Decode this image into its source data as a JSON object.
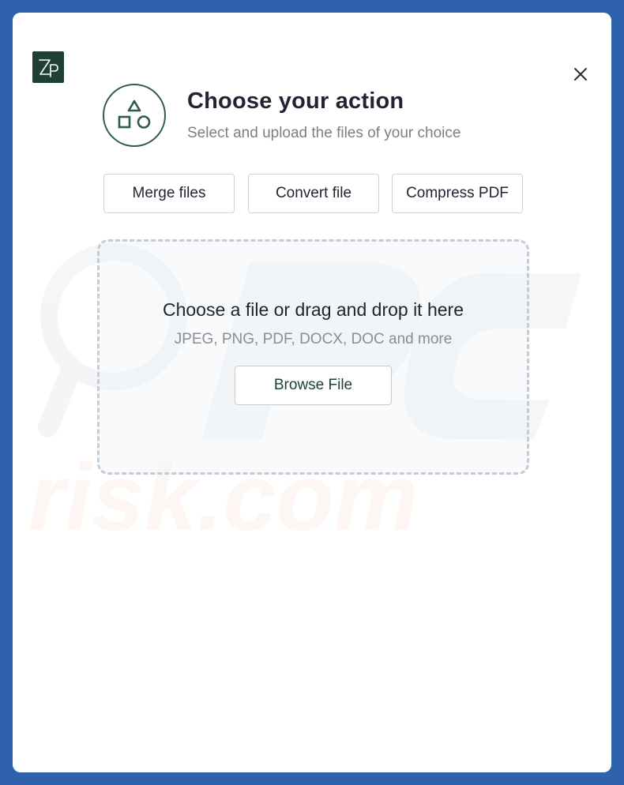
{
  "app": {
    "logo_text": "Zp",
    "close_icon": "close-icon"
  },
  "header": {
    "title": "Choose your action",
    "subtitle": "Select and upload the files of your choice",
    "icon": "shapes-icon"
  },
  "actions": [
    {
      "label": "Merge files"
    },
    {
      "label": "Convert file"
    },
    {
      "label": "Compress PDF"
    }
  ],
  "dropzone": {
    "title": "Choose a file or drag and drop it here",
    "formats": "JPEG, PNG, PDF, DOCX, DOC and more",
    "browse_label": "Browse File"
  },
  "colors": {
    "background": "#2e62ad",
    "brand": "#1e4035",
    "icon_stroke": "#2f5a4c",
    "text": "#1f2430",
    "muted": "#7c7f86",
    "border": "#cfd2d6",
    "dash": "#c6ccd6"
  }
}
